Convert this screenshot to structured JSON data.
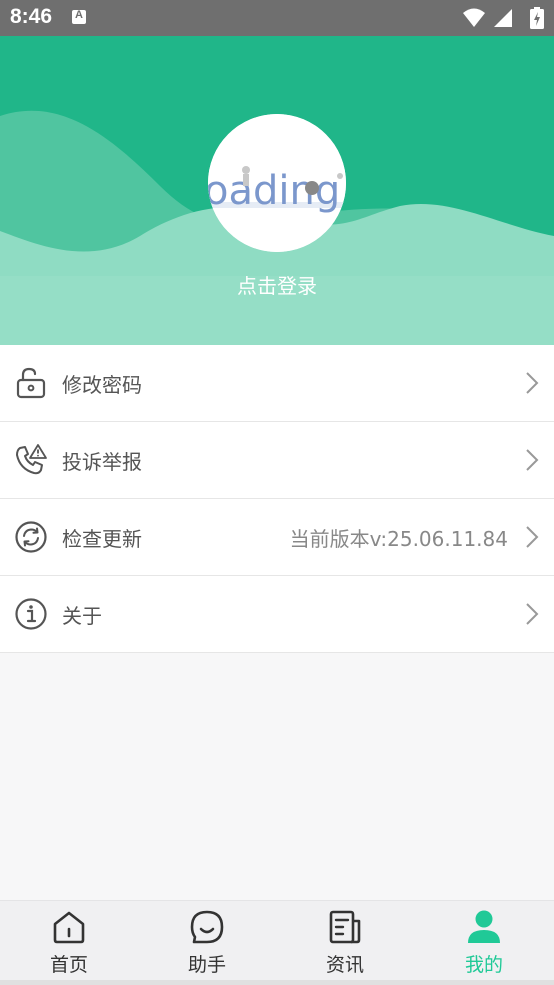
{
  "status_bar": {
    "time": "8:46",
    "notification_icon": "a-box-icon",
    "icons": [
      "wifi-icon",
      "signal-icon",
      "battery-icon"
    ]
  },
  "header": {
    "avatar_text": "oading",
    "login_label": "点击登录",
    "colors": {
      "primary": "#20b689",
      "wave_light": "#8fdcc3"
    }
  },
  "menu": {
    "items": [
      {
        "icon": "unlock-icon",
        "label": "修改密码",
        "value": ""
      },
      {
        "icon": "phone-alert-icon",
        "label": "投诉举报",
        "value": ""
      },
      {
        "icon": "refresh-circle-icon",
        "label": "检查更新",
        "value": "当前版本v:25.06.11.84"
      },
      {
        "icon": "info-circle-icon",
        "label": "关于",
        "value": ""
      }
    ]
  },
  "nav": {
    "items": [
      {
        "icon": "home-icon",
        "label": "首页",
        "active": false
      },
      {
        "icon": "chat-smile-icon",
        "label": "助手",
        "active": false
      },
      {
        "icon": "news-icon",
        "label": "资讯",
        "active": false
      },
      {
        "icon": "user-icon",
        "label": "我的",
        "active": true
      }
    ],
    "active_color": "#20c997"
  }
}
